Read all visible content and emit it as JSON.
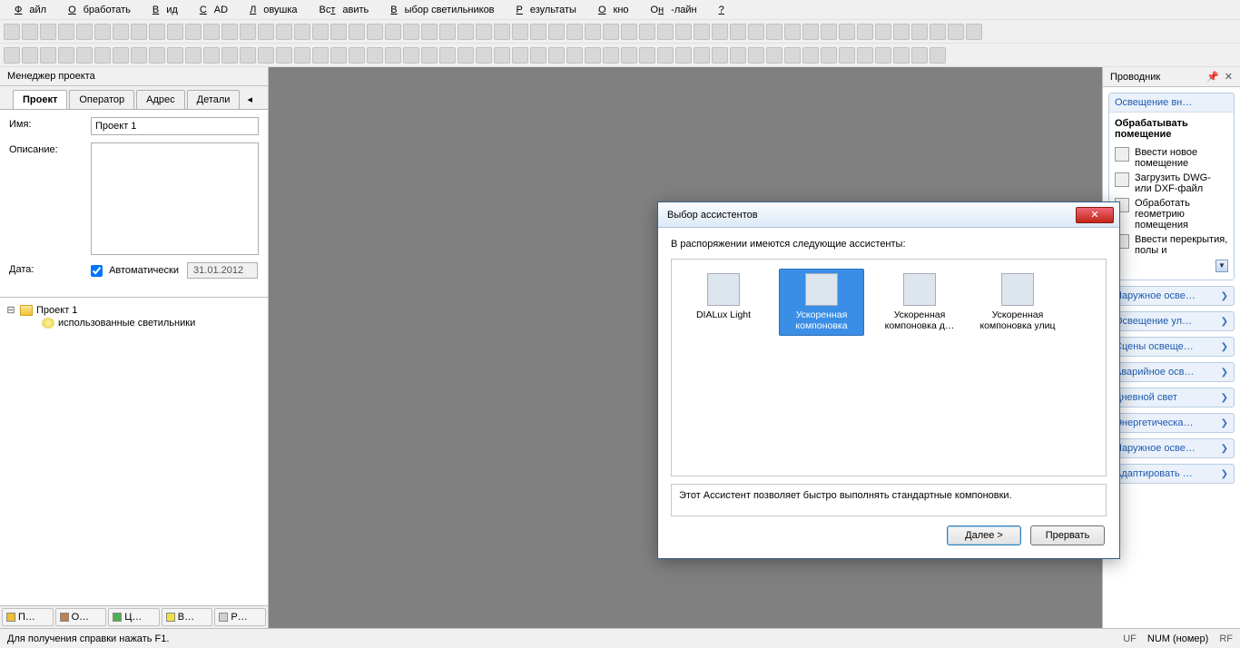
{
  "menu": [
    "Файл",
    "Обработать",
    "Вид",
    "CAD",
    "Ловушка",
    "Вставить",
    "Выбор светильников",
    "Результаты",
    "Окно",
    "Он-лайн",
    "?"
  ],
  "left": {
    "title": "Менеджер проекта",
    "tabs": [
      "Проект",
      "Оператор",
      "Адрес",
      "Детали"
    ],
    "form": {
      "name_label": "Имя:",
      "name_value": "Проект 1",
      "desc_label": "Описание:",
      "date_label": "Дата:",
      "auto_label": "Автоматически",
      "date_value": "31.01.2012"
    },
    "tree": {
      "root": "Проект 1",
      "child": "использованные светильники"
    },
    "bottom_tabs": [
      "П…",
      "О…",
      "Ц…",
      "В…",
      "Р…"
    ]
  },
  "dialog": {
    "title": "Выбор ассистентов",
    "intro": "В распоряжении имеются следующие ассистенты:",
    "items": [
      {
        "label": "DIALux Light"
      },
      {
        "label": "Ускоренная компоновка"
      },
      {
        "label": "Ускоренная компоновка д…"
      },
      {
        "label": "Ускоренная компоновка улиц"
      }
    ],
    "selected": 1,
    "desc": "Этот Ассистент позволяет быстро выполнять стандартные компоновки.",
    "next": "Далее >",
    "cancel": "Прервать"
  },
  "right": {
    "title": "Проводник",
    "sections": [
      {
        "label": "Освещение вн…",
        "expanded": true
      },
      {
        "label": "Наружное осве…"
      },
      {
        "label": "Освещение ул…"
      },
      {
        "label": "Сцены освеще…"
      },
      {
        "label": "Аварийное осв…"
      },
      {
        "label": "Дневной свет"
      },
      {
        "label": "Энергетическа…"
      },
      {
        "label": "Наружное осве…"
      },
      {
        "label": "Адаптировать …"
      }
    ],
    "expanded_section": {
      "subhead": "Обрабатывать помещение",
      "items": [
        "Ввести новое помещение",
        "Загрузить DWG- или DXF-файл",
        "Обработать геометрию помещения",
        "Ввести перекрытия, полы и"
      ]
    }
  },
  "status": {
    "help": "Для получения справки нажать F1.",
    "right": [
      "UF",
      "NUM (номер)",
      "RF"
    ]
  }
}
